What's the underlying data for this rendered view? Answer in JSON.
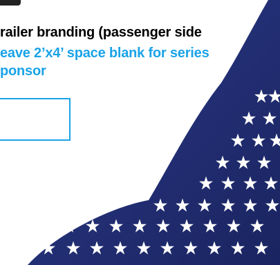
{
  "heading": {
    "text": "railer branding (passenger side"
  },
  "note": {
    "line1": "eave 2’x4’ space blank for series",
    "line2": "ponsor"
  },
  "colors": {
    "heading_text": "#000000",
    "note_text": "#1aa3e8",
    "box_border": "#1aa3e8",
    "flag_blue": "#1f2a6e",
    "star": "#ffffff"
  }
}
